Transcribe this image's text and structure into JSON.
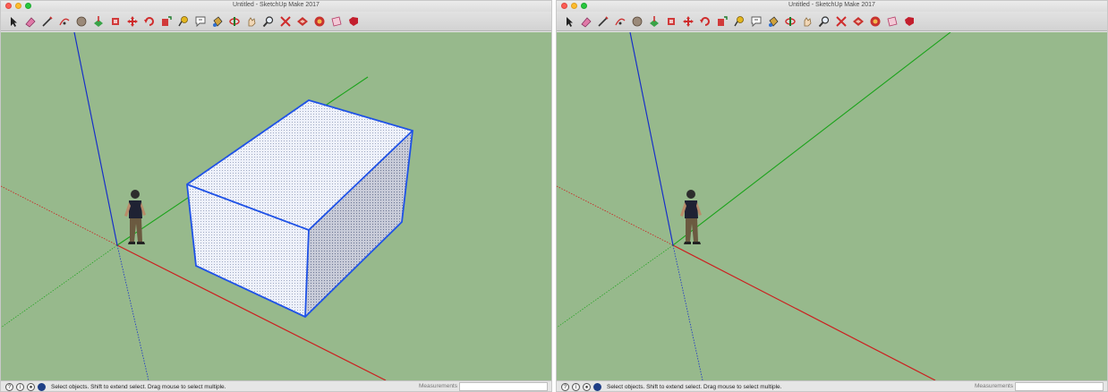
{
  "windows": [
    {
      "title": "Untitled - SketchUp Make 2017",
      "status_text": "Select objects. Shift to extend select. Drag mouse to select multiple.",
      "measurements_label": "Measurements",
      "measurements_value": "",
      "has_box": true
    },
    {
      "title": "Untitled - SketchUp Make 2017",
      "status_text": "Select objects. Shift to extend select. Drag mouse to select multiple.",
      "measurements_label": "Measurements",
      "measurements_value": "",
      "has_box": false
    }
  ],
  "toolbar_tools": [
    "select-icon",
    "eraser-icon",
    "line-icon",
    "arc-icon",
    "shape-icon",
    "push-pull-icon",
    "offset-icon",
    "move-icon",
    "rotate-icon",
    "scale-icon",
    "tape-measure-icon",
    "text-icon",
    "paint-bucket-icon",
    "orbit-icon",
    "pan-icon",
    "zoom-icon",
    "zoom-extents-icon",
    "warehouse-icon",
    "extension-warehouse-icon",
    "layout-icon",
    "ruby-icon"
  ],
  "colors": {
    "ground": "#97b98c",
    "red_axis": "#cc1f1f",
    "green_axis": "#1aa31a",
    "blue_axis": "#1730c8",
    "selection": "#1f52e6"
  }
}
